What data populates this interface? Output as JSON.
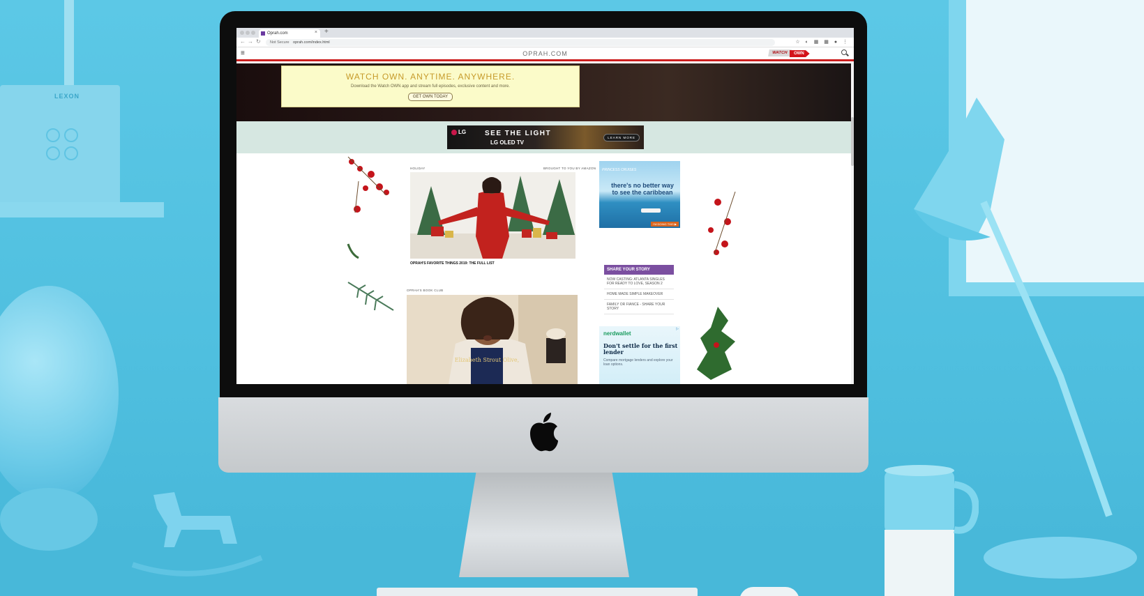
{
  "browser": {
    "tab_title": "Oprah.com",
    "tab_close": "×",
    "new_tab": "+",
    "nav_back": "←",
    "nav_forward": "→",
    "nav_reload": "↻",
    "security_label": "Not Secure",
    "url": "oprah.com/index.html",
    "ext_icons": "☆ ◐ ▦ ▦ ● ⋮"
  },
  "site": {
    "menu_icon": "≡",
    "logo": "OPRAH.COM",
    "watch_label": "WATCH",
    "own_label": "OWN"
  },
  "promo": {
    "title": "WATCH OWN. ANYTIME. ANYWHERE.",
    "subtitle": "Download the Watch OWN app and stream full episodes, exclusive content and more.",
    "button": "GET OWN TODAY"
  },
  "lg_ad": {
    "brand": "LG",
    "headline": "SEE THE LIGHT",
    "product": "LG OLED TV",
    "cta": "LEARN MORE"
  },
  "articles": [
    {
      "category": "HOLIDAY",
      "sponsor": "BROUGHT TO YOU BY AMAZON",
      "caption": "OPRAH'S FAVORITE THINGS 2019: THE FULL LIST"
    },
    {
      "category": "OPRAH'S BOOK CLUB",
      "book_title": "Elizabeth Strout Olive,"
    }
  ],
  "princess_ad": {
    "brand": "PRINCESS CRUISES",
    "text": "there's no better way to see the caribbean",
    "cta": "I'M DOING THIS ▶"
  },
  "share": {
    "title": "SHARE YOUR STORY",
    "links": [
      "NOW CASTING: ATLANTA SINGLES FOR READY TO LOVE, SEASON 2",
      "HOME MADE SIMPLE MAKEOVER",
      "FAMILY OR FIANCE - SHARE YOUR STORY"
    ]
  },
  "nerdwallet_ad": {
    "brand": "nerdwallet",
    "headline": "Don't settle for the first lender",
    "subtext": "Compare mortgage lenders and explore your loan options.",
    "ad_choice": "▷"
  },
  "scene": {
    "lexon_label": "LEXON"
  },
  "colors": {
    "header_red": "#cc1f1f",
    "share_purple": "#7b4fa0",
    "promo_bg": "#fbfbc9",
    "wall_blue": "#5cc8e6"
  }
}
